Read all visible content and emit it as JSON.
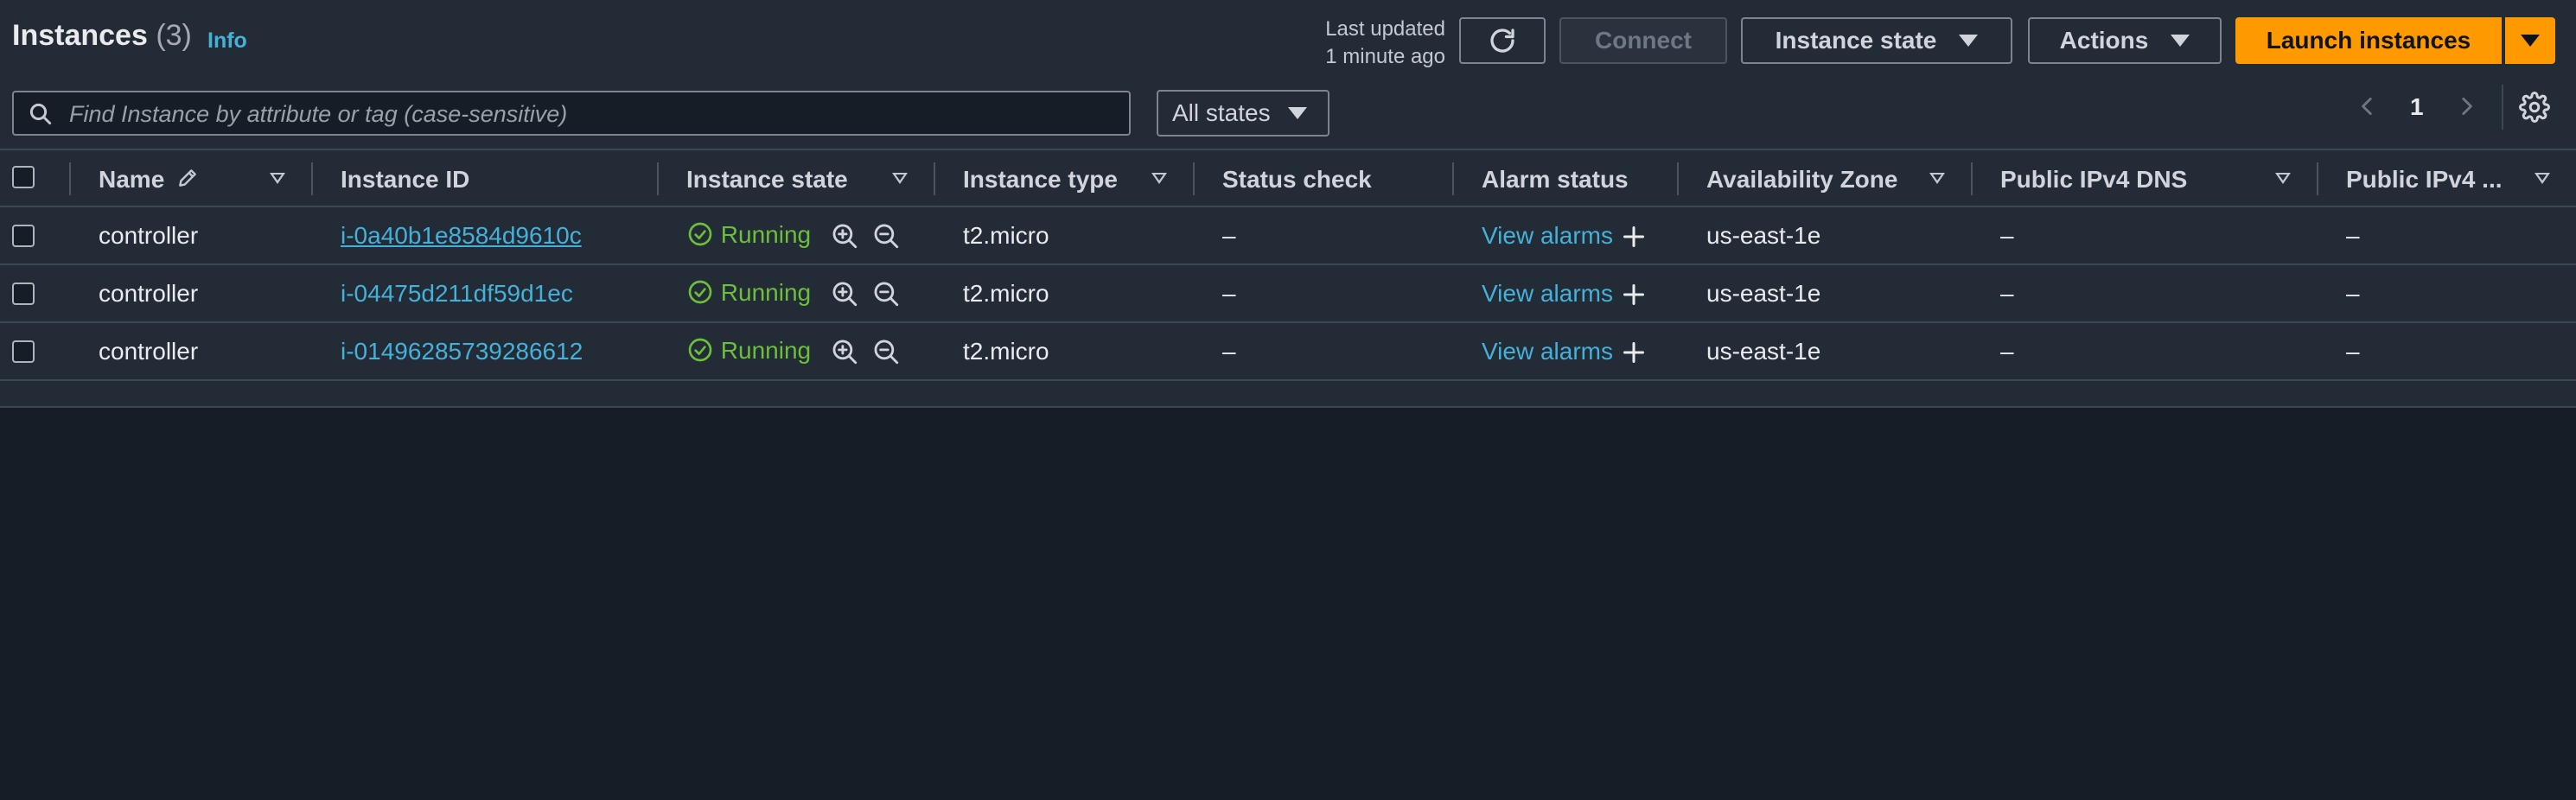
{
  "header": {
    "title": "Instances",
    "count": "(3)",
    "info": "Info",
    "last_updated_line1": "Last updated",
    "last_updated_line2": "1 minute ago"
  },
  "toolbar": {
    "connect": "Connect",
    "instance_state": "Instance state",
    "actions": "Actions",
    "launch": "Launch instances"
  },
  "filter": {
    "placeholder": "Find Instance by attribute or tag (case-sensitive)",
    "states": "All states"
  },
  "pagination": {
    "page": "1"
  },
  "table": {
    "columns": [
      "Name",
      "Instance ID",
      "Instance state",
      "Instance type",
      "Status check",
      "Alarm status",
      "Availability Zone",
      "Public IPv4 DNS",
      "Public IPv4 ..."
    ],
    "rows": [
      {
        "name": "controller",
        "id": "i-0a40b1e8584d9610c",
        "state": "Running",
        "type": "t2.micro",
        "status": "–",
        "alarm": "View alarms",
        "az": "us-east-1e",
        "dns": "–",
        "ip": "–"
      },
      {
        "name": "controller",
        "id": "i-04475d211df59d1ec",
        "state": "Running",
        "type": "t2.micro",
        "status": "–",
        "alarm": "View alarms",
        "az": "us-east-1e",
        "dns": "–",
        "ip": "–"
      },
      {
        "name": "controller",
        "id": "i-01496285739286612",
        "state": "Running",
        "type": "t2.micro",
        "status": "–",
        "alarm": "View alarms",
        "az": "us-east-1e",
        "dns": "–",
        "ip": "–"
      }
    ]
  },
  "colors": {
    "accent": "#ff9900",
    "link": "#45b1d9",
    "running": "#6bbf3b",
    "background": "#161d26",
    "panel": "#232b36"
  },
  "icons": [
    "search-icon",
    "refresh-icon",
    "chevron-left-icon",
    "chevron-right-icon",
    "settings-gear-icon",
    "pencil-icon",
    "check-circle-icon",
    "zoom-in-icon",
    "zoom-out-icon",
    "plus-icon"
  ]
}
